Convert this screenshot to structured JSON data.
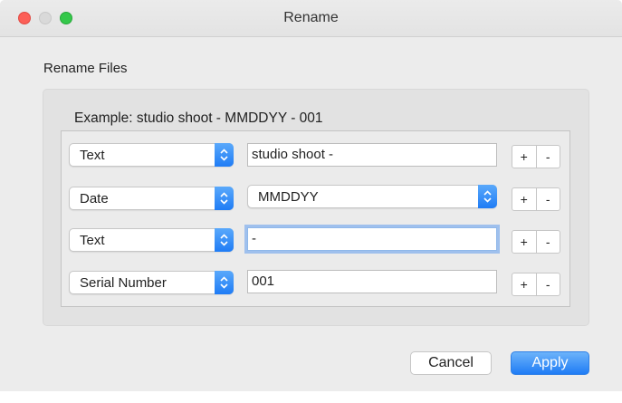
{
  "window": {
    "title": "Rename",
    "controls": [
      "close-button",
      "minimize-button",
      "zoom-button"
    ]
  },
  "section_title": "Rename Files",
  "example": "Example: studio shoot - MMDDYY - 001",
  "rows": [
    {
      "type": "Text",
      "value": "studio shoot -",
      "value_kind": "text-field"
    },
    {
      "type": "Date",
      "value": "MMDDYY",
      "value_kind": "popup"
    },
    {
      "type": "Text",
      "value": "-",
      "value_kind": "text-field",
      "focused": true
    },
    {
      "type": "Serial Number",
      "value": "001",
      "value_kind": "text-field"
    }
  ],
  "row_buttons": {
    "add": "+",
    "remove": "-"
  },
  "buttons": {
    "cancel": "Cancel",
    "apply": "Apply"
  },
  "colors": {
    "accent": "#1f7cf5",
    "close": "#fc5f57",
    "zoom": "#34c84a",
    "focus_ring": "#609cee"
  }
}
